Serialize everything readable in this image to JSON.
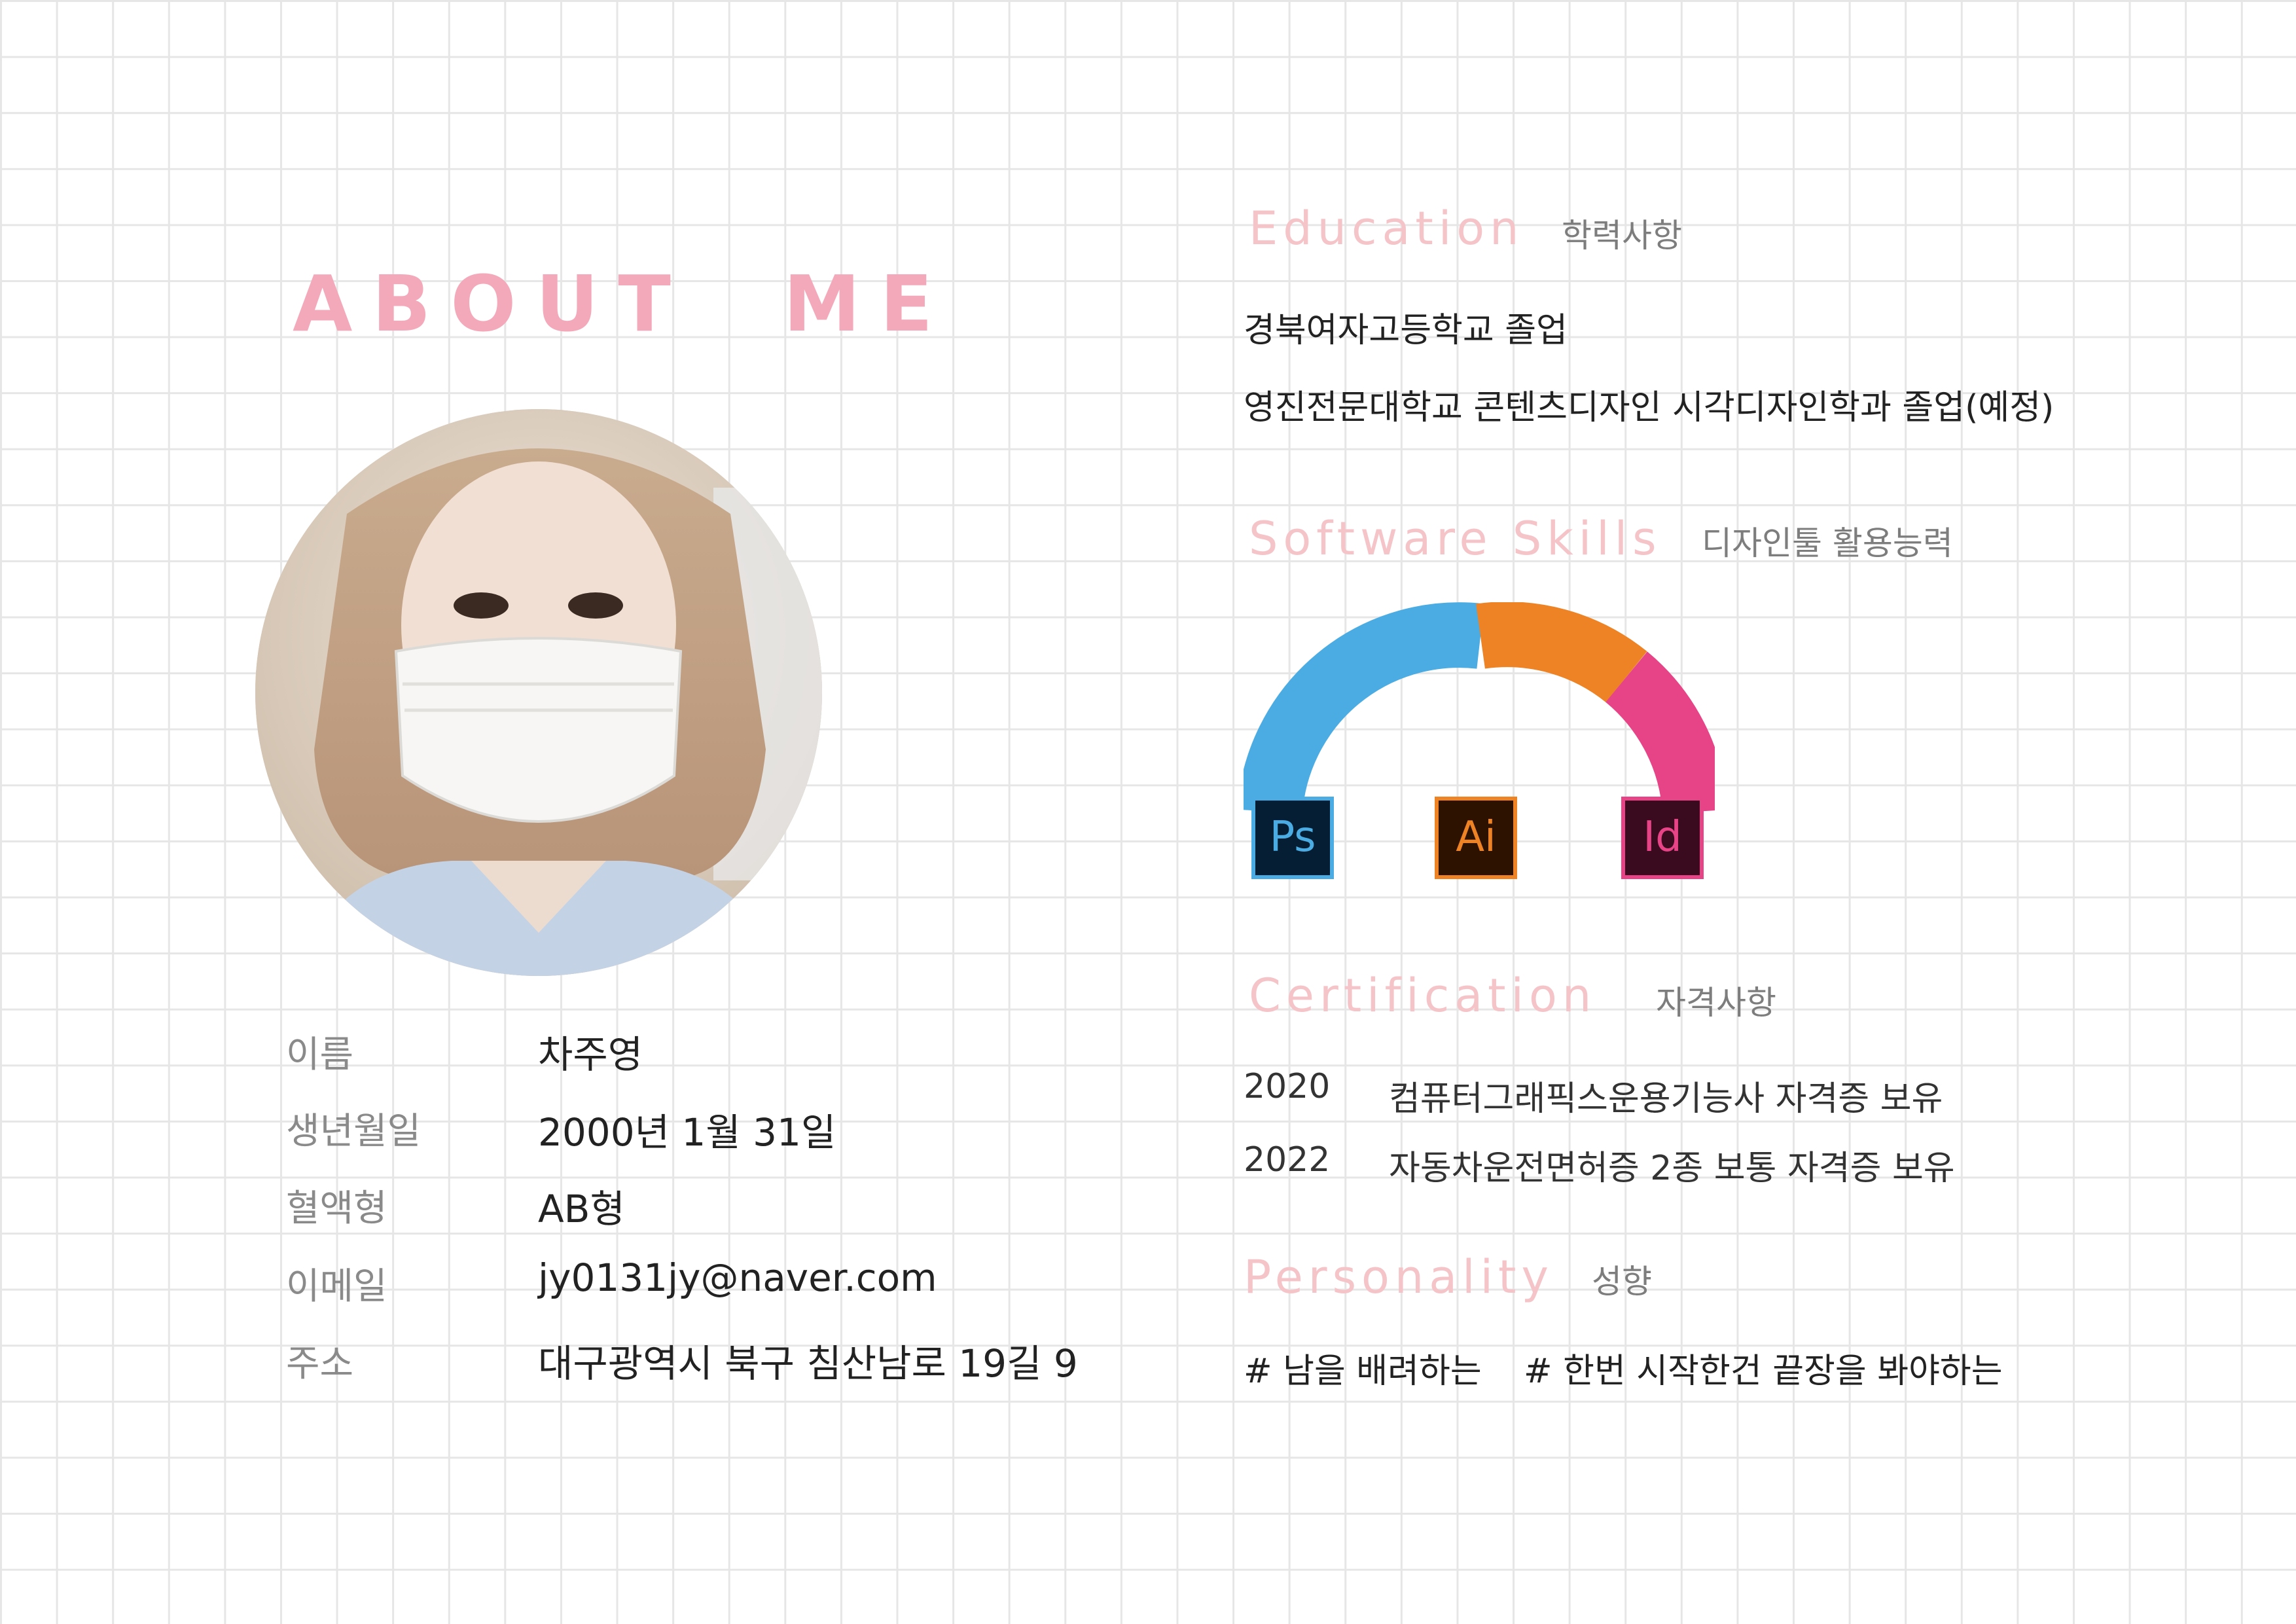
{
  "about": {
    "title": "ABOUT  ME"
  },
  "profile": {
    "rows": [
      {
        "label": "이름",
        "value": "차주영"
      },
      {
        "label": "생년월일",
        "value": "2000년 1월 31일"
      },
      {
        "label": "혈액형",
        "value": "AB형"
      },
      {
        "label": "이메일",
        "value": "jy0131jy@naver.com"
      },
      {
        "label": "주소",
        "value": "대구광역시 북구 침산남로 19길 9"
      }
    ]
  },
  "education": {
    "title": "Education",
    "subtitle": "학력사항",
    "items": [
      "경북여자고등학교 졸업",
      "영진전문대학교 콘텐츠디자인 시각디자인학과 졸업(예정)"
    ]
  },
  "software": {
    "title": "Software Skills",
    "subtitle": "디자인툴 활용능력",
    "tools": [
      {
        "name": "Ps",
        "color": "#4aace3",
        "share": 0.5
      },
      {
        "name": "Ai",
        "color": "#ed8325",
        "share": 0.3
      },
      {
        "name": "Id",
        "color": "#e74387",
        "share": 0.2
      }
    ]
  },
  "certification": {
    "title": "Certification",
    "subtitle": "자격사항",
    "items": [
      {
        "year": "2020",
        "text": "컴퓨터그래픽스운용기능사 자격증 보유"
      },
      {
        "year": "2022",
        "text": "자동차운전면허증 2종 보통 자격증 보유"
      }
    ]
  },
  "personality": {
    "title": "Personality",
    "subtitle": "성향",
    "tags": [
      "# 남을 배려하는",
      "# 한번 시작한건 끝장을 봐야하는"
    ]
  },
  "colors": {
    "accent": "#f4a9ba",
    "section_title": "#f5c4c8"
  }
}
